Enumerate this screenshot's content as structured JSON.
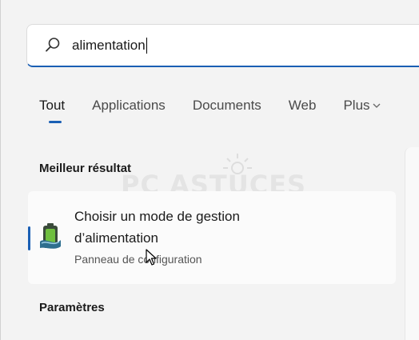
{
  "search": {
    "value": "alimentation",
    "icon": "search-icon"
  },
  "tabs": [
    {
      "label": "Tout",
      "active": true
    },
    {
      "label": "Applications",
      "active": false
    },
    {
      "label": "Documents",
      "active": false
    },
    {
      "label": "Web",
      "active": false
    },
    {
      "label": "Plus",
      "active": false,
      "icon": "chevron-down-icon"
    }
  ],
  "best_result": {
    "heading": "Meilleur résultat",
    "title": "Choisir un mode de gestion d’alimentation",
    "subtitle": "Panneau de configuration",
    "icon": "battery-power-icon"
  },
  "settings": {
    "heading": "Paramètres"
  },
  "watermark": {
    "text": "PC ASTUCES"
  },
  "colors": {
    "accent": "#1a5fb4",
    "background": "#f3f3f3"
  }
}
